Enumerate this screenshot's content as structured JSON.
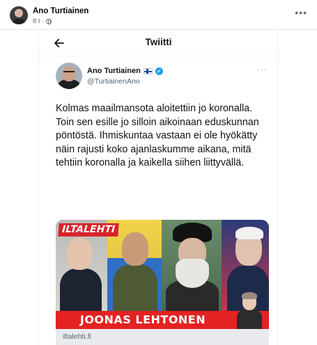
{
  "post": {
    "author": "Ano Turtiainen",
    "time": "8 t ·",
    "more_icon": "more-horizontal-icon",
    "privacy_icon": "globe-icon"
  },
  "tweet": {
    "heading": "Twiitti",
    "back_icon": "arrow-left-icon",
    "author_name": "Ano Turtiainen",
    "handle": "@TurtiainenAno",
    "verified_icon": "verified-badge-icon",
    "flag_icon": "finland-flag-icon",
    "text": "Kolmas maailmansota aloitettiin jo koronalla. Toin sen esille jo silloin aikoinaan eduskunnan pöntöstä. Ihmiskuntaa vastaan ei ole hyökätty näin rajusti koko ajanlaskumme aikana, mitä tehtiin koronalla ja kaikella siihen liittyvällä.",
    "card": {
      "logo": "ILTALEHTI",
      "author": "JOONAS LEHTONEN",
      "domain": "iltalehti.fi"
    }
  },
  "colors": {
    "verified": "#1d9bf0",
    "brand_red": "#d8232a",
    "secondary_text": "#536471"
  }
}
